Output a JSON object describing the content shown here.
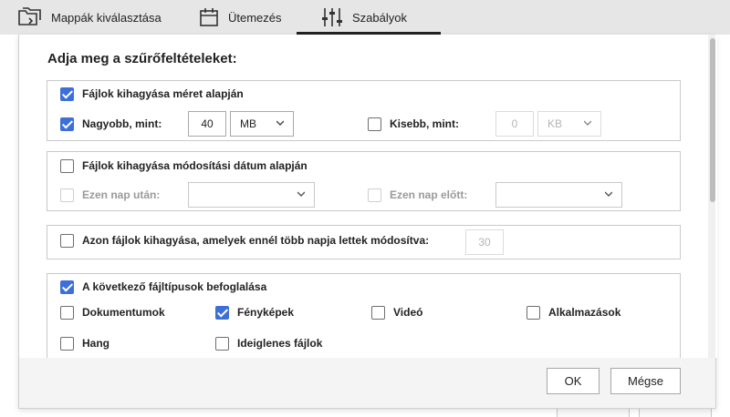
{
  "tabs": [
    {
      "label": "Mappák kiválasztása",
      "icon": "folder-select-icon"
    },
    {
      "label": "Ütemezés",
      "icon": "calendar-icon"
    },
    {
      "label": "Szabályok",
      "icon": "sliders-icon",
      "active": true
    }
  ],
  "dialog": {
    "heading": "Adja meg a szűrőfeltételeket:",
    "size_filter": {
      "label": "Fájlok kihagyása méret alapján",
      "checked": true,
      "larger": {
        "label": "Nagyobb, mint:",
        "checked": true,
        "value": "40",
        "unit": "MB"
      },
      "smaller": {
        "label": "Kisebb, mint:",
        "checked": false,
        "value": "0",
        "unit": "KB"
      }
    },
    "date_filter": {
      "label": "Fájlok kihagyása módosítási dátum alapján",
      "checked": false,
      "after": {
        "label": "Ezen nap után:",
        "value": ""
      },
      "before": {
        "label": "Ezen nap előtt:",
        "value": ""
      }
    },
    "age_filter": {
      "label": "Azon fájlok kihagyása, amelyek ennél több napja lettek módosítva:",
      "checked": false,
      "value": "30"
    },
    "type_filter": {
      "label": "A következő fájltípusok befoglalása",
      "checked": true,
      "types": [
        {
          "label": "Dokumentumok",
          "checked": false
        },
        {
          "label": "Fényképek",
          "checked": true
        },
        {
          "label": "Videó",
          "checked": false
        },
        {
          "label": "Alkalmazások",
          "checked": false
        },
        {
          "label": "Hang",
          "checked": false
        },
        {
          "label": "Ideiglenes fájlok",
          "checked": false
        }
      ]
    },
    "ok_label": "OK",
    "cancel_label": "Mégse"
  },
  "colors": {
    "accent": "#3d6fd8",
    "tabbar": "#e6e6e6"
  }
}
